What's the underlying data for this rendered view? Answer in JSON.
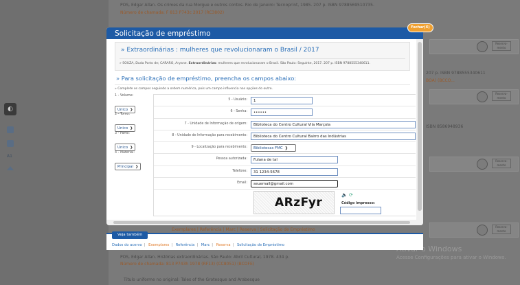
{
  "modal": {
    "title": "Solicitação de empréstimo",
    "close_label": "Fechar(X)"
  },
  "book": {
    "title": "» Extraordinárias : mulheres que revolucionaram o Brasil / 2017",
    "ref_prefix": "» SOUZA, Duda Porto de; CARARO, Aryane.",
    "ref_bold": "Extraordinárias",
    "ref_suffix": ": mulheres que revolucionaram o Brasil. São Paulo: Seguinte, 2017. 207 p. ISBN 9788555340611."
  },
  "form": {
    "title": "» Para solicitação de empréstimo, preencha os campos abaixo:",
    "note": "» Complete os campos seguindo a ordem numérica, pois um campo influencia nas opções do outro.",
    "left": [
      {
        "label": "1 - Volume:",
        "value": "Unico"
      },
      {
        "label": "2 - Tomo:",
        "value": "Unico"
      },
      {
        "label": "3 - Parte:",
        "value": "Unico"
      },
      {
        "label": "4 - Material:",
        "value": "Principal"
      }
    ],
    "rows": [
      {
        "label": "5 - Usuário:",
        "value": "1"
      },
      {
        "label": "6 - Senha:",
        "value": "••••••"
      },
      {
        "label": "7 - Unidade de Informação de origem:",
        "value": "Biblioteca do Centro Cultural Vila Marçola"
      },
      {
        "label": "8 - Unidade de Informação para recebimento:",
        "value": "Biblioteca do Centro Cultural Bairro das Indústrias"
      },
      {
        "label": "9 - Localização para recebimento:",
        "value": "Bibliotecas FMC"
      },
      {
        "label": "Pessoa autorizada:",
        "value": "Fulana de tal"
      },
      {
        "label": "Telefone:",
        "value": "31 1234-5678"
      },
      {
        "label": "Email:",
        "value": "seuemail@gmail.com"
      }
    ],
    "captcha": {
      "text": "ARzFyr",
      "label": "Código impresso:"
    }
  },
  "see_also": {
    "tab": "Veja também",
    "links": [
      "Dados do acervo",
      "Exemplares",
      "Referência",
      "Marc",
      "Reserva",
      "Solicitação de Empréstimo"
    ]
  },
  "background": {
    "line1": "POS, Edgar Allan. Os crimes da rua Morgue e outros contos. Rio de Janeiro: Tecnoprint, 1985. 207 p. ISBN 9788569510735.",
    "line2": "Número de chamada:  F 813 P743c 2017 (RC3802)",
    "line3": "POS, Edgar Allan. Histórias extraordinárias. São Paulo: Abril Cultural, 1978. 434 p.",
    "line4": "Número de chamada:  813 P743h 1978 (RF13) (CC8051) (BCOFE)",
    "line5": "Título uniforme no original: Tales of the Grotesque and Arabesque",
    "line6": "207 p. ISBN 9788555340611",
    "line7": "BOA) (BCCO...",
    "line8": "ISBN 8586948936",
    "line9": "Exemplares  |  Referência  |  Marc  |  Reserva  |  Solicitação de Empréstimo",
    "reserve_label": "Reserva-\nmento",
    "windows_title": "Ativar o Windows",
    "windows_sub": "Acesse Configurações para ativar o Windows."
  }
}
